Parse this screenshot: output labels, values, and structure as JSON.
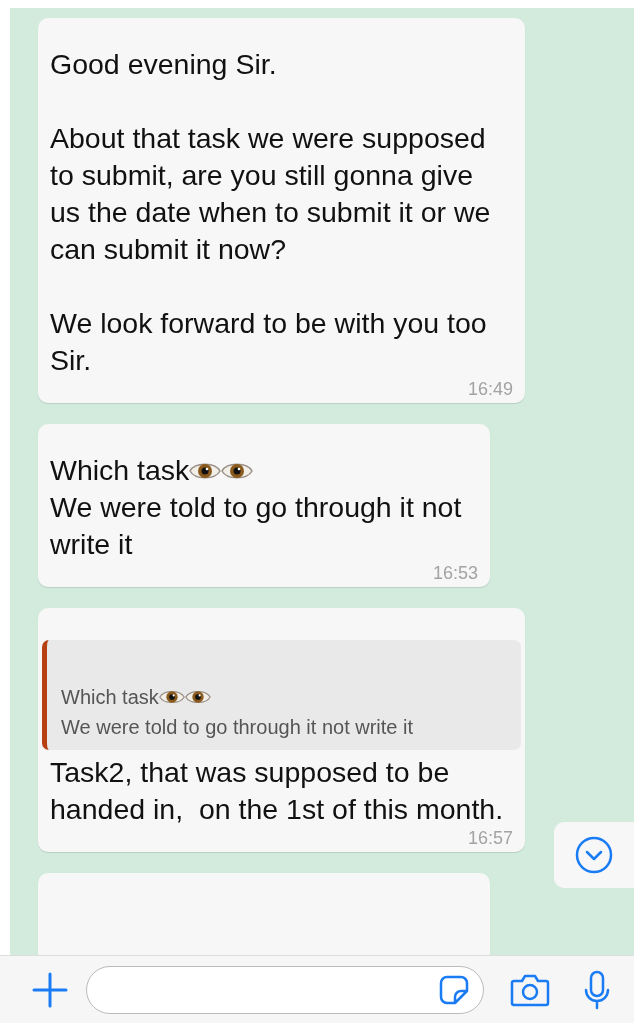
{
  "messages": [
    {
      "kind": "text",
      "text": "Good evening Sir.\n\nAbout that task we were supposed to submit, are you still gonna give us the date when to submit it or we can submit it now?\n\nWe look forward to be with you too Sir.",
      "time": "16:49"
    },
    {
      "kind": "text",
      "lines": [
        {
          "kind": "with_eyes",
          "text": "Which task"
        },
        {
          "kind": "plain",
          "text": "We were told to go through it not write it"
        }
      ],
      "time": "16:53"
    },
    {
      "kind": "reply",
      "quote": {
        "lines": [
          {
            "kind": "with_eyes",
            "text": "Which task"
          },
          {
            "kind": "plain",
            "text": "We were told to go through it not write it"
          }
        ]
      },
      "text": "Task2, that was supposed to be handed in,  on the 1st of this month.",
      "time": "16:57"
    },
    {
      "kind": "cut_off"
    }
  ]
}
